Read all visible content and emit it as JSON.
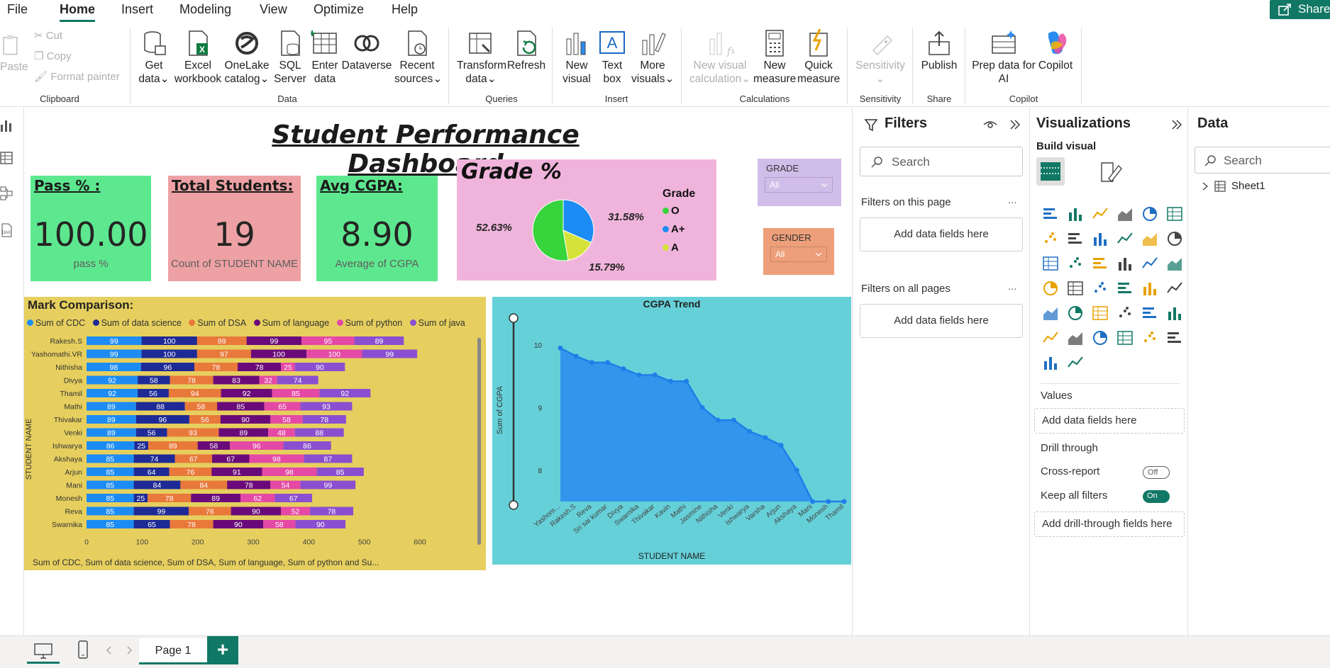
{
  "menu": {
    "items": [
      "File",
      "Home",
      "Insert",
      "Modeling",
      "View",
      "Optimize",
      "Help"
    ],
    "share": "Share"
  },
  "ribbon": {
    "paste": "Paste",
    "cut": "Cut",
    "copy": "Copy",
    "format_painter": "Format painter",
    "get_data": [
      "Get",
      "data"
    ],
    "excel": [
      "Excel",
      "workbook"
    ],
    "onelake": [
      "OneLake",
      "catalog"
    ],
    "sql": [
      "SQL",
      "Server"
    ],
    "enter_data": [
      "Enter",
      "data"
    ],
    "dataverse": "Dataverse",
    "recent": [
      "Recent",
      "sources"
    ],
    "transform": [
      "Transform",
      "data"
    ],
    "refresh": "Refresh",
    "new_visual": [
      "New",
      "visual"
    ],
    "text_box": [
      "Text",
      "box"
    ],
    "more_visuals": [
      "More",
      "visuals"
    ],
    "new_visual_calc": [
      "New visual",
      "calculation"
    ],
    "new_measure": [
      "New",
      "measure"
    ],
    "quick_measure": [
      "Quick",
      "measure"
    ],
    "sensitivity": "Sensitivity",
    "publish": "Publish",
    "prep_data": [
      "Prep data for",
      "AI"
    ],
    "copilot": "Copilot",
    "groups": {
      "clipboard": "Clipboard",
      "data": "Data",
      "queries": "Queries",
      "insert": "Insert",
      "calculations": "Calculations",
      "sensitivity": "Sensitivity",
      "share": "Share",
      "copilot": "Copilot"
    }
  },
  "colors": {
    "accent": "#117865",
    "card_green": "#5de88f",
    "card_red": "#eda1a4",
    "grade_bg": "#f0b4dc",
    "mark_bg": "#e6cf5e",
    "cgpa_bg": "#66d0d8"
  },
  "report": {
    "title": "Student Performance Dashboard",
    "pass_card": {
      "title": "Pass % :",
      "value": "100.00",
      "label": "pass %"
    },
    "total_card": {
      "title": "Total Students:",
      "value": "19",
      "label": "Count of STUDENT NAME"
    },
    "cgpa_card": {
      "title": "Avg CGPA:",
      "value": "8.90",
      "label": "Average of CGPA"
    },
    "grade_slicer": {
      "title": "GRADE",
      "value": "All"
    },
    "gender_slicer": {
      "title": "GENDER",
      "value": "All"
    }
  },
  "chart_data": [
    {
      "type": "pie",
      "title": "Grade %",
      "legend_title": "Grade",
      "legend_placement": "right",
      "categories": [
        "O",
        "A+",
        "A"
      ],
      "values": [
        52.63,
        31.58,
        15.79
      ],
      "labels": [
        "52.63%",
        "31.58%",
        "15.79%"
      ],
      "colors": [
        "#37d43b",
        "#1c8cf4",
        "#d4e23a"
      ]
    },
    {
      "type": "bar",
      "orientation": "horizontal",
      "stacked": true,
      "title": "Mark Comparison:",
      "xlabel": "Sum of CDC, Sum of data science, Sum of DSA, Sum of language, Sum of python and Su...",
      "ylabel": "STUDENT NAME",
      "xlim": [
        0,
        600
      ],
      "xticks": [
        0,
        100,
        200,
        300,
        400,
        500,
        600
      ],
      "legend_placement": "top",
      "categories": [
        "Rakesh.S",
        "Yashomathi.VR",
        "Nithisha",
        "Divya",
        "Thamil",
        "Mathi",
        "Thivakar",
        "Venki",
        "Ishwarya",
        "Akshaya",
        "Arjun",
        "Mani",
        "Monesh",
        "Reva",
        "Swarnika"
      ],
      "series": [
        {
          "name": "Sum of CDC",
          "color": "#1c8cf4",
          "values": [
            99,
            99,
            98,
            92,
            92,
            89,
            89,
            89,
            86,
            85,
            85,
            85,
            85,
            85,
            85
          ]
        },
        {
          "name": "Sum of data science",
          "color": "#1e2a96",
          "values": [
            100,
            100,
            96,
            58,
            56,
            88,
            96,
            56,
            25,
            74,
            64,
            84,
            25,
            99,
            65
          ]
        },
        {
          "name": "Sum of DSA",
          "color": "#e8793b",
          "values": [
            89,
            97,
            78,
            78,
            94,
            58,
            56,
            93,
            89,
            67,
            76,
            84,
            78,
            76,
            78
          ]
        },
        {
          "name": "Sum of language",
          "color": "#6a0a7a",
          "values": [
            99,
            100,
            78,
            83,
            92,
            85,
            90,
            89,
            58,
            67,
            91,
            78,
            89,
            90,
            90
          ]
        },
        {
          "name": "Sum of python",
          "color": "#e449a5",
          "values": [
            95,
            100,
            25,
            32,
            85,
            65,
            58,
            48,
            96,
            98,
            98,
            54,
            62,
            52,
            58
          ]
        },
        {
          "name": "Sum of java",
          "color": "#8a4fd0",
          "values": [
            89,
            99,
            90,
            74,
            92,
            93,
            78,
            88,
            86,
            87,
            85,
            99,
            67,
            78,
            90
          ]
        }
      ]
    },
    {
      "type": "area",
      "title": "CGPA Trend",
      "xlabel": "STUDENT NAME",
      "ylabel": "Sum of CGPA",
      "ylim": [
        7.5,
        10
      ],
      "yticks": [
        8,
        9,
        10
      ],
      "color": "#2a8cf0",
      "x": [
        "Yashom...",
        "Rakesh.S",
        "Reva",
        "Sri sai kumar",
        "Divya",
        "Swarnika",
        "Thivakar",
        "Kavin",
        "Mathi",
        "Jasmine",
        "Nithisha",
        "Venki",
        "Ishwarya",
        "Varsha",
        "Arjun",
        "Akshaya",
        "Mani",
        "Monesh",
        "Thamil"
      ],
      "y": [
        9.95,
        9.82,
        9.72,
        9.72,
        9.62,
        9.52,
        9.52,
        9.42,
        9.42,
        9.0,
        8.8,
        8.8,
        8.62,
        8.52,
        8.4,
        8.0,
        7.5,
        7.5,
        7.5
      ]
    }
  ],
  "filters": {
    "title": "Filters",
    "search_placeholder": "Search",
    "this_page": "Filters on this page",
    "all_pages": "Filters on all pages",
    "add_fields": "Add data fields here",
    "dots": "..."
  },
  "viz": {
    "title": "Visualizations",
    "build": "Build visual",
    "values": "Values",
    "add_values": "Add data fields here",
    "drill": "Drill through",
    "cross": "Cross-report",
    "cross_state": "Off",
    "keep": "Keep all filters",
    "keep_state": "On",
    "add_drill": "Add drill-through fields here",
    "py": "Py",
    "r": "R",
    "num": "123",
    "more": "..."
  },
  "data_pane": {
    "title": "Data",
    "search_placeholder": "Search",
    "table": "Sheet1"
  },
  "pages": {
    "current": "Page 1",
    "add": "+"
  }
}
